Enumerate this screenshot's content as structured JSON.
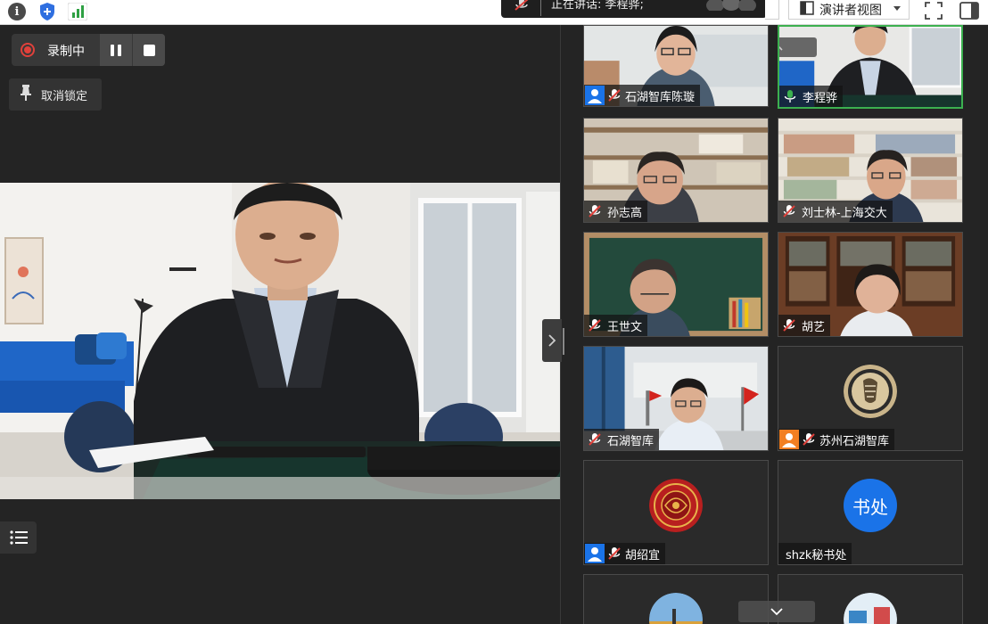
{
  "topbar": {
    "speaking_text": "正在讲话: 李程骅;",
    "view_label": "演讲者视图"
  },
  "recording": {
    "label": "录制中"
  },
  "unpin": {
    "label": "取消锁定"
  },
  "gallery": {
    "participants": [
      {
        "name": "石湖智库陈璇",
        "type_icon": "user-icon",
        "muted": true
      },
      {
        "name": "李程骅",
        "type_icon": "none",
        "muted": false,
        "speaking": true
      },
      {
        "name": "孙志高",
        "type_icon": "none",
        "muted": true
      },
      {
        "name": "刘士林-上海交大",
        "type_icon": "none",
        "muted": true
      },
      {
        "name": "王世文",
        "type_icon": "none",
        "muted": true
      },
      {
        "name": "胡艺",
        "type_icon": "none",
        "muted": true
      },
      {
        "name": "石湖智库",
        "type_icon": "none",
        "muted": true
      },
      {
        "name": "苏州石湖智库",
        "type_icon": "user-orange-icon",
        "muted": true
      },
      {
        "name": "胡绍宜",
        "type_icon": "user-icon",
        "muted": true
      },
      {
        "name": "shzk秘书处",
        "type_icon": "none",
        "muted": false,
        "avatar_text": "书处"
      }
    ]
  },
  "colors": {
    "speaking_green": "#3cb04f",
    "record_red": "#e0413b",
    "user_blue": "#1a73e8",
    "user_orange": "#f27f22"
  }
}
